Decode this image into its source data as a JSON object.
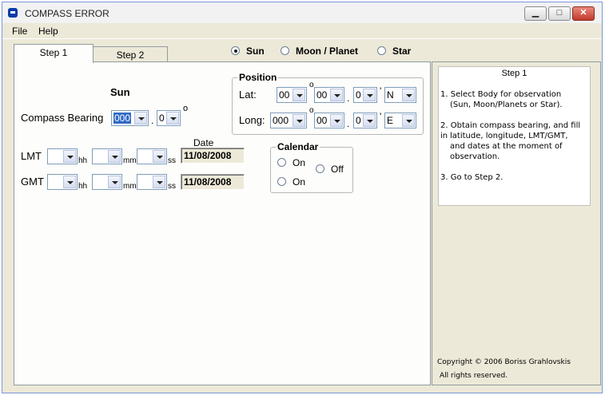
{
  "window": {
    "title": "COMPASS ERROR",
    "minimize_glyph": "▁",
    "maximize_glyph": "□",
    "close_glyph": "✕"
  },
  "menu": {
    "file": "File",
    "help": "Help"
  },
  "tabs": [
    "Step 1",
    "Step 2"
  ],
  "body_select": {
    "options": [
      "Sun",
      "Moon / Planet",
      "Star"
    ],
    "selected": "Sun"
  },
  "step1": {
    "heading": "Sun",
    "compass_bearing": {
      "label": "Compass Bearing",
      "degrees": "000",
      "tenths": "0",
      "deg_symbol": "o",
      "separator": "."
    },
    "position": {
      "title": "Position",
      "lat": {
        "label": "Lat:",
        "deg": "00",
        "min": "00",
        "tenths": "0",
        "hemi": "N"
      },
      "long": {
        "label": "Long:",
        "deg": "000",
        "min": "00",
        "tenths": "0",
        "hemi": "E"
      },
      "deg_symbol": "o",
      "min_symbol": "'",
      "separator": "."
    },
    "date_header": "Date",
    "lmt": {
      "label": "LMT",
      "hh_unit": "hh",
      "mm_unit": "mm",
      "ss_unit": "ss",
      "date": "11/08/2008"
    },
    "gmt": {
      "label": "GMT",
      "hh_unit": "hh",
      "mm_unit": "mm",
      "ss_unit": "ss",
      "date": "11/08/2008"
    },
    "calendar": {
      "title": "Calendar",
      "lmt_on": "On",
      "gmt_on": "On",
      "off": "Off"
    }
  },
  "help": {
    "title": "Step 1",
    "items": [
      "1. Select Body for observation",
      "(Sun, Moon/Planets or Star).",
      "2. Obtain compass bearing, and fill in",
      "latitude, longitude,  LMT/GMT,",
      "and dates at the moment of",
      "observation.",
      "3. Go to Step 2."
    ],
    "copyright": "Copyright © 2006 Boriss Grahlovskis",
    "rights": "All rights reserved."
  }
}
